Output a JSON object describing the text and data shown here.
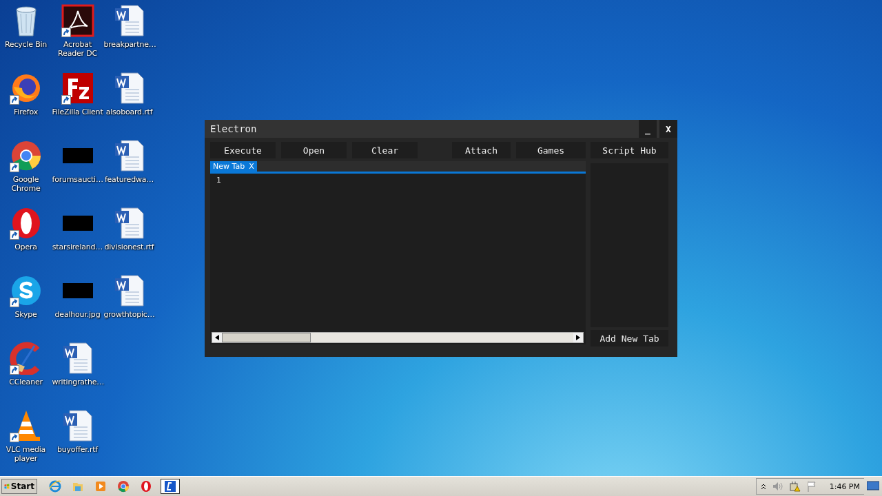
{
  "desktop_icons": [
    {
      "label": "Recycle Bin",
      "kind": "recycle",
      "shortcut": false
    },
    {
      "label": "Firefox",
      "kind": "firefox",
      "shortcut": true
    },
    {
      "label": "Google Chrome",
      "kind": "chrome",
      "shortcut": true
    },
    {
      "label": "Opera",
      "kind": "opera",
      "shortcut": true
    },
    {
      "label": "Skype",
      "kind": "skype",
      "shortcut": true
    },
    {
      "label": "CCleaner",
      "kind": "ccleaner",
      "shortcut": true
    },
    {
      "label": "VLC media player",
      "kind": "vlc",
      "shortcut": true
    },
    {
      "label": "Acrobat Reader DC",
      "kind": "acrobat",
      "shortcut": true
    },
    {
      "label": "FileZilla Client",
      "kind": "filezilla",
      "shortcut": true
    },
    {
      "label": "forumsaucti…",
      "kind": "image",
      "shortcut": false
    },
    {
      "label": "starsireland…",
      "kind": "image",
      "shortcut": false
    },
    {
      "label": "dealhour.jpg",
      "kind": "image",
      "shortcut": false
    },
    {
      "label": "writingrathe…",
      "kind": "word",
      "shortcut": false
    },
    {
      "label": "buyoffer.rtf",
      "kind": "word",
      "shortcut": false
    },
    {
      "label": "breakpartne…",
      "kind": "word",
      "shortcut": false
    },
    {
      "label": "alsoboard.rtf",
      "kind": "word",
      "shortcut": false
    },
    {
      "label": "featuredwa…",
      "kind": "word",
      "shortcut": false
    },
    {
      "label": "divisionest.rtf",
      "kind": "word",
      "shortcut": false
    },
    {
      "label": "growthtopic…",
      "kind": "word",
      "shortcut": false
    }
  ],
  "window": {
    "title": "Electron",
    "minimize": "_",
    "close": "X",
    "left_buttons": [
      "Execute",
      "Open",
      "Clear"
    ],
    "right_buttons": [
      "Attach",
      "Games",
      "Script Hub"
    ],
    "tabs": [
      {
        "label": "New Tab",
        "close": "X",
        "selected": true
      }
    ],
    "line_numbers": [
      "1"
    ],
    "add_tab": "Add New Tab"
  },
  "taskbar": {
    "start": "Start",
    "apps": [
      {
        "kind": "ie",
        "selected": false
      },
      {
        "kind": "folder",
        "selected": false
      },
      {
        "kind": "media",
        "selected": false
      },
      {
        "kind": "chrome",
        "selected": false
      },
      {
        "kind": "opera",
        "selected": false
      },
      {
        "kind": "electron",
        "selected": true
      }
    ],
    "clock": "1:46 PM"
  }
}
